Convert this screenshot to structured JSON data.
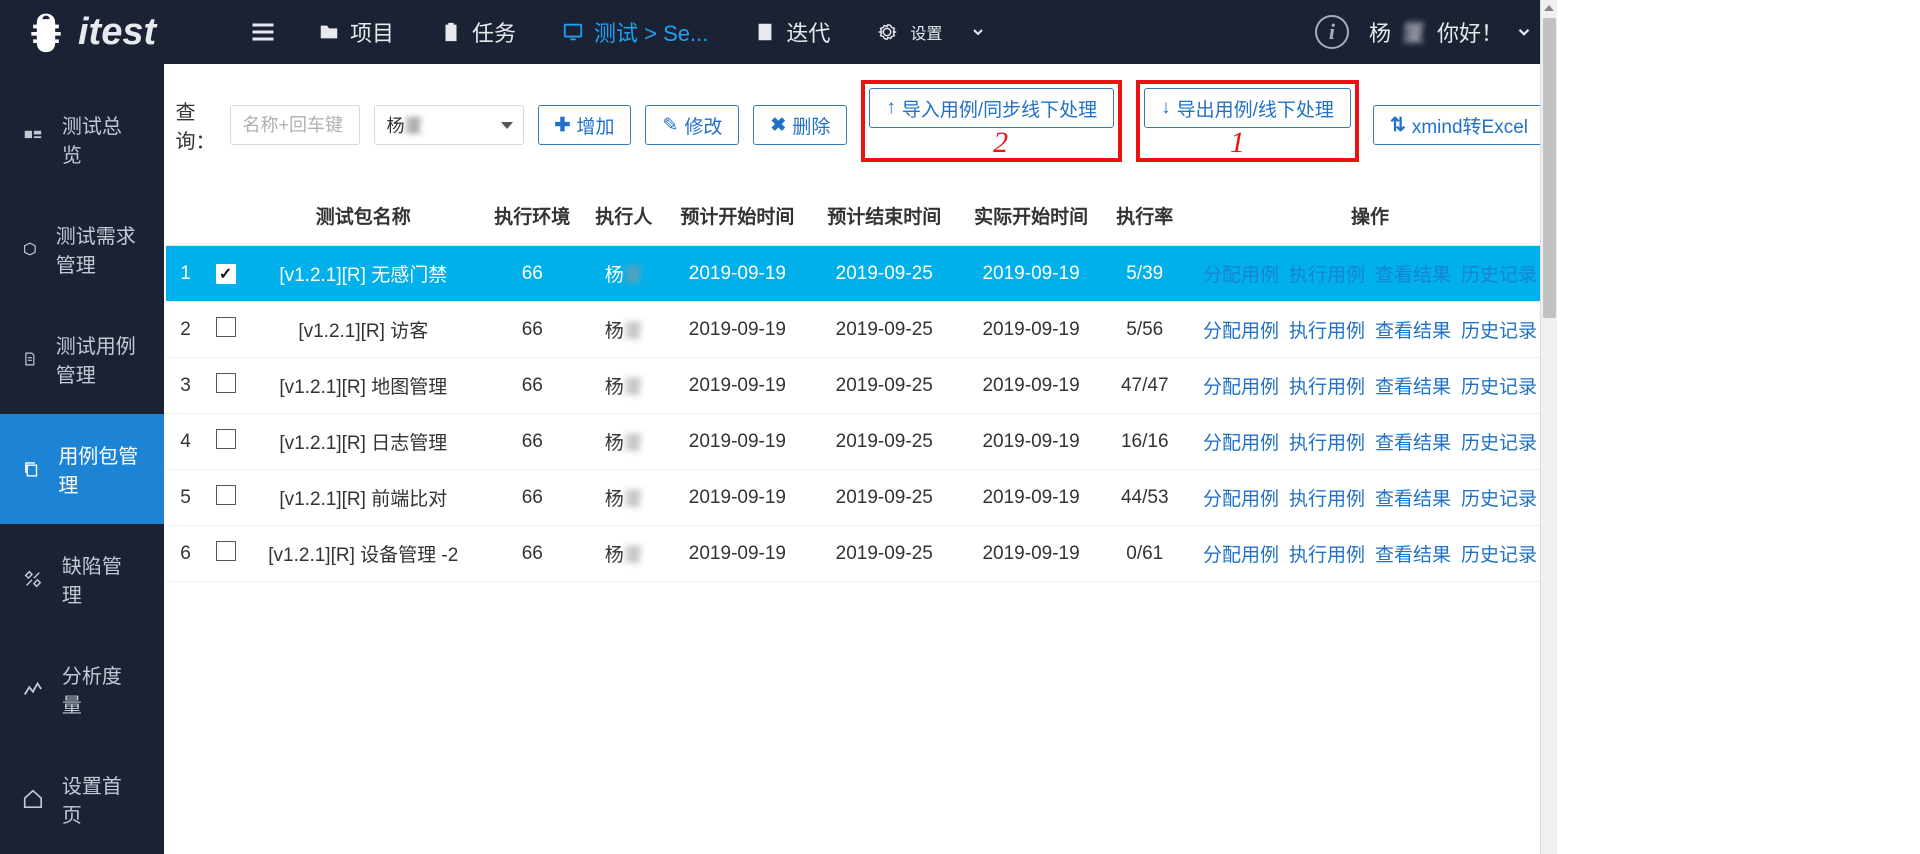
{
  "app": {
    "logo_text": "itest"
  },
  "topnav": {
    "items": [
      {
        "label": "项目"
      },
      {
        "label": "任务"
      },
      {
        "label": "测试 > Se..."
      },
      {
        "label": "迭代"
      },
      {
        "label": "设置"
      }
    ],
    "user_prefix": "杨",
    "user_suffix": "你好！"
  },
  "sidebar": {
    "items": [
      {
        "label": "测试总览"
      },
      {
        "label": "测试需求管理"
      },
      {
        "label": "测试用例管理"
      },
      {
        "label": "用例包管理"
      },
      {
        "label": "缺陷管理"
      },
      {
        "label": "分析度量"
      },
      {
        "label": "设置首页"
      }
    ]
  },
  "toolbar": {
    "query_label": "查询：",
    "query_placeholder": "名称+回车键",
    "select_text": "杨",
    "add": "增加",
    "edit": "修改",
    "delete": "删除",
    "import": "导入用例/同步线下处理",
    "export": "导出用例/线下处理",
    "xmind": "xmind转Excel",
    "annot1": "1",
    "annot2": "2"
  },
  "table": {
    "headers": {
      "name": "测试包名称",
      "env": "执行环境",
      "exec": "执行人",
      "plan_start": "预计开始时间",
      "plan_end": "预计结束时间",
      "actual_start": "实际开始时间",
      "rate": "执行率",
      "ops": "操作"
    },
    "actions": {
      "assign": "分配用例",
      "execute": "执行用例",
      "result": "查看结果",
      "history": "历史记录"
    },
    "rows": [
      {
        "idx": "1",
        "checked": true,
        "selected": true,
        "name": "[v1.2.1][R] 无感门禁",
        "env": "66",
        "exec": "杨",
        "ps": "2019-09-19",
        "pe": "2019-09-25",
        "as": "2019-09-19",
        "rate": "5/39"
      },
      {
        "idx": "2",
        "checked": false,
        "selected": false,
        "name": "[v1.2.1][R] 访客",
        "env": "66",
        "exec": "杨",
        "ps": "2019-09-19",
        "pe": "2019-09-25",
        "as": "2019-09-19",
        "rate": "5/56"
      },
      {
        "idx": "3",
        "checked": false,
        "selected": false,
        "name": "[v1.2.1][R] 地图管理",
        "env": "66",
        "exec": "杨",
        "ps": "2019-09-19",
        "pe": "2019-09-25",
        "as": "2019-09-19",
        "rate": "47/47"
      },
      {
        "idx": "4",
        "checked": false,
        "selected": false,
        "name": "[v1.2.1][R] 日志管理",
        "env": "66",
        "exec": "杨",
        "ps": "2019-09-19",
        "pe": "2019-09-25",
        "as": "2019-09-19",
        "rate": "16/16"
      },
      {
        "idx": "5",
        "checked": false,
        "selected": false,
        "name": "[v1.2.1][R] 前端比对",
        "env": "66",
        "exec": "杨",
        "ps": "2019-09-19",
        "pe": "2019-09-25",
        "as": "2019-09-19",
        "rate": "44/53"
      },
      {
        "idx": "6",
        "checked": false,
        "selected": false,
        "name": "[v1.2.1][R] 设备管理 -2",
        "env": "66",
        "exec": "杨",
        "ps": "2019-09-19",
        "pe": "2019-09-25",
        "as": "2019-09-19",
        "rate": "0/61"
      }
    ]
  }
}
